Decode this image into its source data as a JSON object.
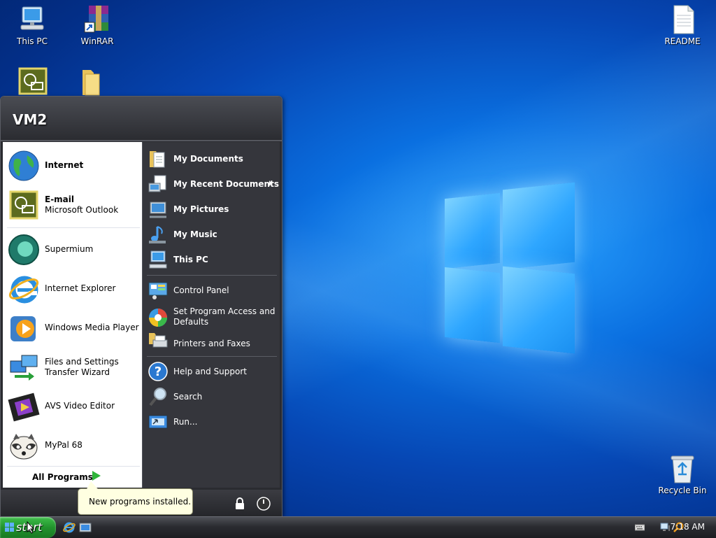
{
  "desktop": {
    "icons": [
      {
        "label": "This PC"
      },
      {
        "label": "WinRAR"
      },
      {
        "label": "README"
      },
      {
        "label": "Recycle Bin"
      }
    ]
  },
  "start_menu": {
    "user_name": "VM2",
    "left_items": [
      {
        "title": "Internet",
        "subtitle": ""
      },
      {
        "title": "E-mail",
        "subtitle": "Microsoft Outlook"
      },
      {
        "title": "Supermium"
      },
      {
        "title": "Internet Explorer"
      },
      {
        "title": "Windows Media Player"
      },
      {
        "title": "Files and Settings",
        "title2": "Transfer Wizard"
      },
      {
        "title": "AVS Video Editor"
      },
      {
        "title": "MyPal 68"
      }
    ],
    "all_programs_label": "All Programs",
    "right_items": [
      {
        "label": "My Documents"
      },
      {
        "label": "My Recent Documents"
      },
      {
        "label": "My Pictures"
      },
      {
        "label": "My Music"
      },
      {
        "label": "This PC"
      },
      {
        "label": "Control Panel"
      },
      {
        "label": "Set Program Access and",
        "label2": "Defaults"
      },
      {
        "label": "Printers and Faxes"
      },
      {
        "label": "Help and Support"
      },
      {
        "label": "Search"
      },
      {
        "label": "Run..."
      }
    ]
  },
  "balloon": {
    "text": "New programs installed."
  },
  "taskbar": {
    "start_label": "start",
    "clock": "7:18 AM"
  },
  "colors": {
    "start_green": "#22922d",
    "menu_dark": "#2a2b30",
    "desktop_blue": "#0646b3"
  }
}
